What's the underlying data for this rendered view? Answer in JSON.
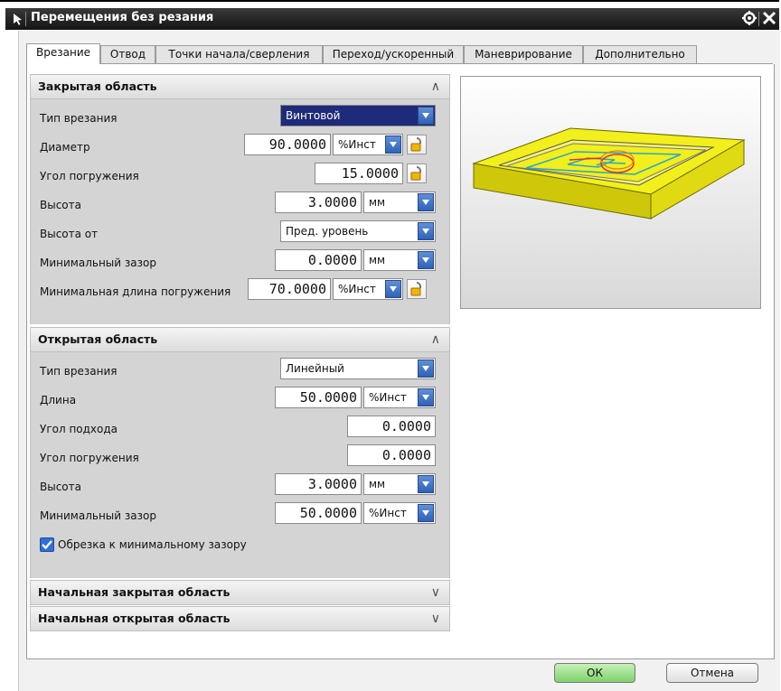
{
  "window": {
    "title": "Перемещения без резания"
  },
  "tabs": [
    {
      "label": "Врезание",
      "active": true
    },
    {
      "label": "Отвод",
      "active": false
    },
    {
      "label": "Точки начала/сверления",
      "active": false
    },
    {
      "label": "Переход/ускоренный",
      "active": false
    },
    {
      "label": "Маневрирование",
      "active": false
    },
    {
      "label": "Дополнительно",
      "active": false
    }
  ],
  "closed_area": {
    "header": "Закрытая область",
    "chevron": "∧",
    "rows": [
      {
        "label": "Тип врезания",
        "value": "Винтовой"
      },
      {
        "label": "Диаметр",
        "value": "90.0000",
        "unit": "%Инст"
      },
      {
        "label": "Угол погружения",
        "value": "15.0000"
      },
      {
        "label": "Высота",
        "value": "3.0000",
        "unit": "мм"
      },
      {
        "label": "Высота от",
        "value": "Пред. уровень"
      },
      {
        "label": "Минимальный зазор",
        "value": "0.0000",
        "unit": "мм"
      },
      {
        "label": "Минимальная длина погружения",
        "value": "70.0000",
        "unit": "%Инст"
      }
    ]
  },
  "open_area": {
    "header": "Открытая область",
    "chevron": "∧",
    "rows": [
      {
        "label": "Тип врезания",
        "value": "Линейный"
      },
      {
        "label": "Длина",
        "value": "50.0000",
        "unit": "%Инст"
      },
      {
        "label": "Угол подхода",
        "value": "0.0000"
      },
      {
        "label": "Угол погружения",
        "value": "0.0000"
      },
      {
        "label": "Высота",
        "value": "3.0000",
        "unit": "мм"
      },
      {
        "label": "Минимальный зазор",
        "value": "50.0000",
        "unit": "%Инст"
      }
    ],
    "checkbox": {
      "label": "Обрезка к минимальному зазору",
      "checked": true
    }
  },
  "collapsed_sections": [
    {
      "header": "Начальная закрытая область",
      "chevron": "∨"
    },
    {
      "header": "Начальная открытая область",
      "chevron": "∨"
    }
  ],
  "buttons": {
    "ok": "ОК",
    "cancel": "Отмена"
  },
  "colors": {
    "accent": "#2f62b8",
    "part": "#f2ef1c",
    "ok_button": "#7dd36a"
  }
}
